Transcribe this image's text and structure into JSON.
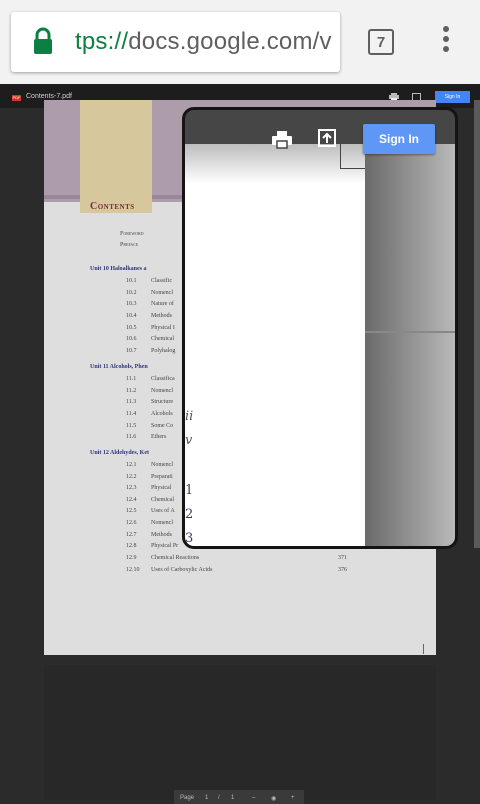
{
  "browser": {
    "url_scheme": "tps://",
    "url_host": "docs.google.com/v",
    "tab_count": "7",
    "accent_color": "#0b8043"
  },
  "viewer": {
    "file_badge": "PDF",
    "file_name": "Contents-7.pdf",
    "signin_label": "Sign In"
  },
  "document": {
    "heading": "Contents",
    "front_matter": [
      "Foreword",
      "Preface"
    ],
    "units": [
      {
        "title": "Unit 10  Haloalkanes  a",
        "items": [
          {
            "num": "10.1",
            "text": "Classific"
          },
          {
            "num": "10.2",
            "text": "Nomencl"
          },
          {
            "num": "10.3",
            "text": "Nature of"
          },
          {
            "num": "10.4",
            "text": "Methods"
          },
          {
            "num": "10.5",
            "text": "Physical I"
          },
          {
            "num": "10.6",
            "text": "Chemical"
          },
          {
            "num": "10.7",
            "text": "Polyhalog"
          }
        ]
      },
      {
        "title": "Unit 11  Alcohols, Phen",
        "items": [
          {
            "num": "11.1",
            "text": "Classifica"
          },
          {
            "num": "11.2",
            "text": "Nomencl"
          },
          {
            "num": "11.3",
            "text": "Structure"
          },
          {
            "num": "11.4",
            "text": "Alcohols"
          },
          {
            "num": "11.5",
            "text": "Some Co"
          },
          {
            "num": "11.6",
            "text": "Ethers"
          }
        ]
      },
      {
        "title": "Unit 12  Aldehydes, Ket",
        "items": [
          {
            "num": "12.1",
            "text": "Nomencl"
          },
          {
            "num": "12.2",
            "text": "Preparati"
          },
          {
            "num": "12.3",
            "text": "Physical"
          },
          {
            "num": "12.4",
            "text": "Chemical"
          },
          {
            "num": "12.5",
            "text": "Uses of A"
          },
          {
            "num": "12.6",
            "text": "Nomencl"
          },
          {
            "num": "12.7",
            "text": "Methods"
          },
          {
            "num": "12.8",
            "text": "Physical Pr"
          },
          {
            "num": "12.9",
            "text": "Chemical Reactions",
            "page": "371"
          },
          {
            "num": "12.10",
            "text": "Uses of Carboxylic Acids",
            "page": "376"
          }
        ]
      }
    ]
  },
  "popup": {
    "signin_label": "Sign In",
    "roman_numerals": [
      "ii",
      "v"
    ],
    "numbers": [
      "1",
      "2",
      "3"
    ]
  },
  "page_nav": {
    "label": "Page",
    "current": "1",
    "separator": "/",
    "total": "1"
  }
}
